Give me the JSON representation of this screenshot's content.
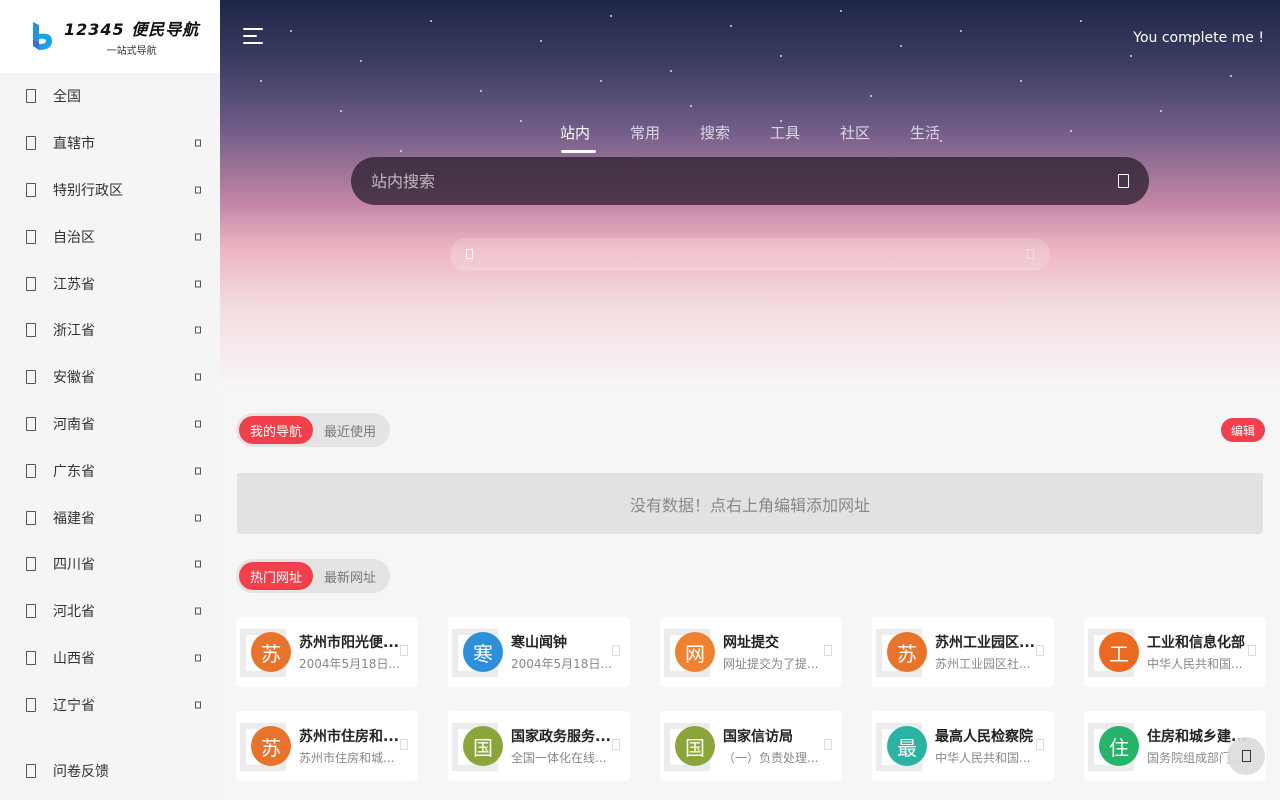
{
  "logo": {
    "title": "12345 便民导航",
    "subtitle": "一站式导航"
  },
  "sidebar": {
    "items": [
      {
        "label": "全国",
        "has_arrow": false
      },
      {
        "label": "直辖市",
        "has_arrow": true
      },
      {
        "label": "特别行政区",
        "has_arrow": true
      },
      {
        "label": "自治区",
        "has_arrow": true
      },
      {
        "label": "江苏省",
        "has_arrow": true
      },
      {
        "label": "浙江省",
        "has_arrow": true
      },
      {
        "label": "安徽省",
        "has_arrow": true
      },
      {
        "label": "河南省",
        "has_arrow": true
      },
      {
        "label": "广东省",
        "has_arrow": true
      },
      {
        "label": "福建省",
        "has_arrow": true
      },
      {
        "label": "四川省",
        "has_arrow": true
      },
      {
        "label": "河北省",
        "has_arrow": true
      },
      {
        "label": "山西省",
        "has_arrow": true
      },
      {
        "label": "辽宁省",
        "has_arrow": true
      }
    ],
    "bottom": {
      "label": "问卷反馈"
    }
  },
  "header": {
    "slogan": "You complete me !"
  },
  "search": {
    "tabs": [
      "站内",
      "常用",
      "搜索",
      "工具",
      "社区",
      "生活"
    ],
    "active_tab": 0,
    "placeholder": "站内搜索"
  },
  "my_nav": {
    "tabs": [
      "我的导航",
      "最近使用"
    ],
    "active_tab": 0,
    "edit_label": "编辑",
    "empty_text": "没有数据！点右上角编辑添加网址"
  },
  "hot": {
    "tabs": [
      "热门网址",
      "最新网址"
    ],
    "active_tab": 0,
    "cards": [
      {
        "badge": "苏",
        "color": "#e8732a",
        "name": "苏州市阳光便...",
        "desc": "2004年5月18日..."
      },
      {
        "badge": "寒",
        "color": "#2d8fd8",
        "name": "寒山闻钟",
        "desc": "2004年5月18日..."
      },
      {
        "badge": "网",
        "color": "#f0812f",
        "name": "网址提交",
        "desc": "网址提交为了提..."
      },
      {
        "badge": "苏",
        "color": "#e8732a",
        "name": "苏州工业园区...",
        "desc": "苏州工业园区社..."
      },
      {
        "badge": "工",
        "color": "#ea6b1f",
        "name": "工业和信息化部",
        "desc": "中华人民共和国..."
      },
      {
        "badge": "苏",
        "color": "#e8732a",
        "name": "苏州市住房和...",
        "desc": "苏州市住房和城..."
      },
      {
        "badge": "国",
        "color": "#8aa63a",
        "name": "国家政务服务...",
        "desc": "全国一体化在线..."
      },
      {
        "badge": "国",
        "color": "#8aa63a",
        "name": "国家信访局",
        "desc": "（一）负责处理..."
      },
      {
        "badge": "最",
        "color": "#2ab3a3",
        "name": "最高人民检察院",
        "desc": "中华人民共和国..."
      },
      {
        "badge": "住",
        "color": "#26b36c",
        "name": "住房和城乡建...",
        "desc": "国务院组成部门..."
      }
    ]
  }
}
